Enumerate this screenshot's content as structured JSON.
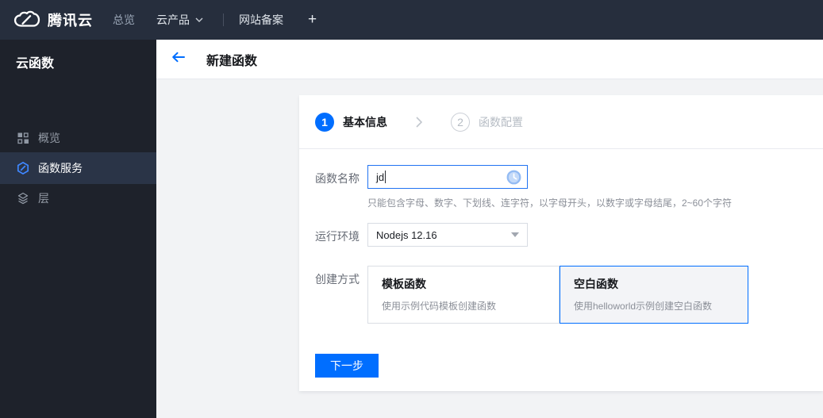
{
  "colors": {
    "accent": "#006eff",
    "navbar_bg": "#262e3d",
    "sidebar_bg": "#1e222b",
    "sidebar_active_bg": "#2a3447",
    "content_bg": "#f2f3f5",
    "selected_card_bg": "#f3f4f7",
    "focused_input_border": "#2173f2"
  },
  "navbar": {
    "brand": "腾讯云",
    "items": [
      {
        "label": "总览"
      },
      {
        "label": "云产品"
      },
      {
        "label": "网站备案"
      },
      {
        "label": "+"
      }
    ]
  },
  "sidebar": {
    "title": "云函数",
    "items": [
      {
        "label": "概览",
        "icon": "grid-icon",
        "active": false
      },
      {
        "label": "函数服务",
        "icon": "function-hexagon-icon",
        "active": true
      },
      {
        "label": "层",
        "icon": "layers-icon",
        "active": false
      }
    ]
  },
  "header": {
    "title": "新建函数"
  },
  "wizard": {
    "steps": [
      {
        "number": "1",
        "label": "基本信息",
        "state": "current"
      },
      {
        "number": "2",
        "label": "函数配置",
        "state": "upcoming"
      }
    ]
  },
  "form": {
    "function_name": {
      "label": "函数名称",
      "value": "jd",
      "hint": "只能包含字母、数字、下划线、连字符，以字母开头，以数字或字母结尾，2~60个字符"
    },
    "runtime": {
      "label": "运行环境",
      "value": "Nodejs 12.16"
    },
    "creation_method": {
      "label": "创建方式",
      "options": [
        {
          "title": "模板函数",
          "desc": "使用示例代码模板创建函数",
          "selected": false
        },
        {
          "title": "空白函数",
          "desc": "使用helloworld示例创建空白函数",
          "selected": true
        }
      ]
    }
  },
  "actions": {
    "next": "下一步"
  }
}
